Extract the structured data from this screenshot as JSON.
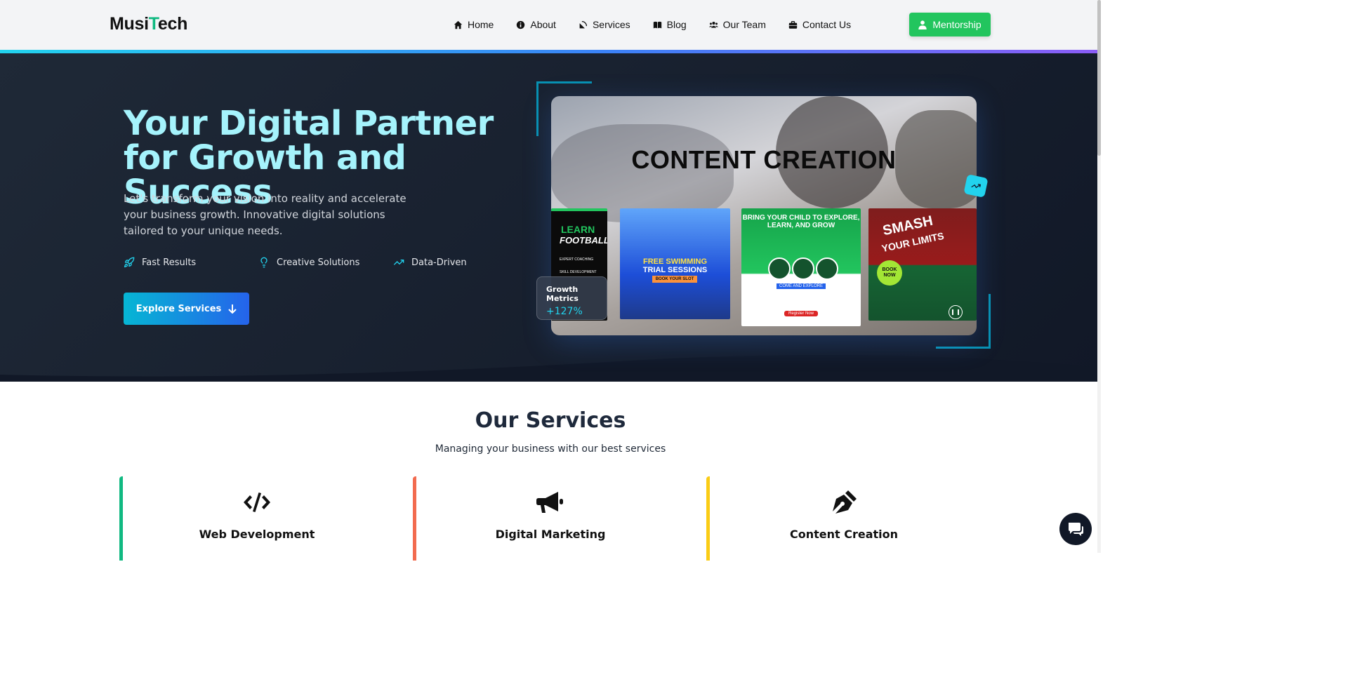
{
  "brand": {
    "logo_prefix": "Musi",
    "logo_t": "T",
    "logo_suffix": "ech"
  },
  "nav": {
    "items": [
      {
        "label": "Home",
        "icon": "home-icon"
      },
      {
        "label": "About",
        "icon": "info-icon"
      },
      {
        "label": "Services",
        "icon": "satellite-dish-icon"
      },
      {
        "label": "Blog",
        "icon": "book-icon"
      },
      {
        "label": "Our Team",
        "icon": "users-icon"
      },
      {
        "label": "Contact Us",
        "icon": "briefcase-icon"
      }
    ],
    "cta_label": "Mentorship",
    "cta_icon": "user-tie-icon"
  },
  "hero": {
    "title": "Your Digital Partner for Growth and Success",
    "subtitle": "Let's transform your vision into reality and accelerate your business growth. Innovative digital solutions tailored to your unique needs.",
    "features": [
      {
        "label": "Fast Results",
        "icon": "rocket-icon"
      },
      {
        "label": "Creative Solutions",
        "icon": "lightbulb-icon"
      },
      {
        "label": "Data-Driven",
        "icon": "trending-up-icon"
      }
    ],
    "button_label": "Explore Services",
    "media": {
      "headline": "CONTENT CREATION",
      "poster1": {
        "line1": "LEARN",
        "line2": "FOOTBALL",
        "items": [
          "EXPERT COACHING",
          "SKILL DEVELOPMENT"
        ]
      },
      "poster2": {
        "line1": "FREE SWIMMING",
        "line2": "TRIAL SESSIONS",
        "tag": "BOOK YOUR SLOT"
      },
      "poster3": {
        "headline": "BRING YOUR CHILD TO EXPLORE, LEARN, AND GROW",
        "tag": "COME AND EXPLORE",
        "cta": "Register Now"
      },
      "poster4": {
        "line1": "SMASH",
        "line2": "YOUR LIMITS",
        "badge": "BOOK NOW"
      }
    },
    "metric": {
      "label": "Growth Metrics",
      "value": "+127%"
    }
  },
  "services": {
    "title": "Our Services",
    "subtitle": "Managing your business with our best services",
    "cards": [
      {
        "name": "Web Development",
        "icon": "code-icon",
        "accent": "#10b981"
      },
      {
        "name": "Digital Marketing",
        "icon": "megaphone-icon",
        "accent": "#f26b4f"
      },
      {
        "name": "Content Creation",
        "icon": "pen-nib-icon",
        "accent": "#facc15"
      }
    ]
  },
  "colors": {
    "primary_cyan": "#a5f3fc",
    "cta_green": "#22c55e",
    "hero_bg": "#1f2937"
  }
}
